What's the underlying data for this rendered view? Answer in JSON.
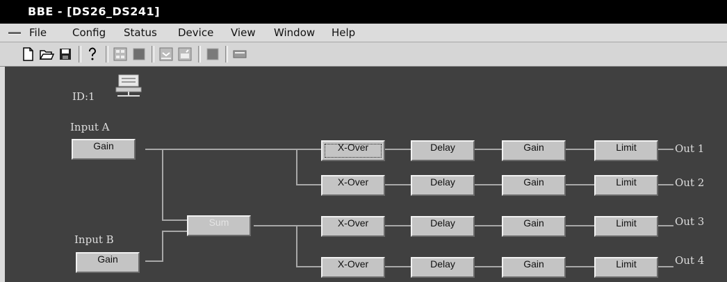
{
  "window": {
    "title": "BBE - [DS26_DS241]"
  },
  "menu": [
    "File",
    "Config",
    "Status",
    "Device",
    "View",
    "Window",
    "Help"
  ],
  "toolbar": [
    "new-file-icon",
    "open-folder-icon",
    "save-icon",
    "help-icon",
    "layout-icon",
    "stop-icon",
    "download-icon",
    "upload-icon",
    "block-icon",
    "device-panel-icon"
  ],
  "device": {
    "id_label": "ID:1"
  },
  "inputs": {
    "a_label": "Input A",
    "b_label": "Input B",
    "gain_label": "Gain"
  },
  "sum_label": "Sum",
  "chain_labels": {
    "xover": "X-Over",
    "delay": "Delay",
    "gain": "Gain",
    "limit": "Limit"
  },
  "outputs": [
    "Out 1",
    "Out 2",
    "Out 3",
    "Out 4"
  ]
}
